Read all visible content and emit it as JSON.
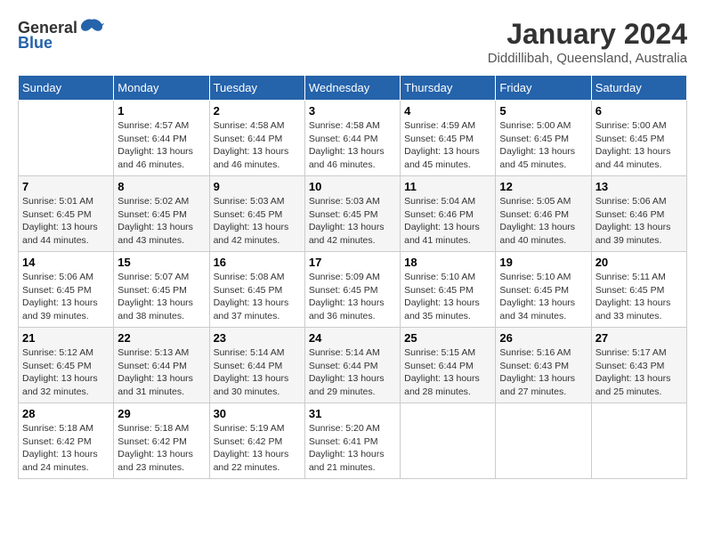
{
  "header": {
    "logo_general": "General",
    "logo_blue": "Blue",
    "month_year": "January 2024",
    "location": "Diddillibah, Queensland, Australia"
  },
  "weekdays": [
    "Sunday",
    "Monday",
    "Tuesday",
    "Wednesday",
    "Thursday",
    "Friday",
    "Saturday"
  ],
  "weeks": [
    [
      {
        "day": "",
        "sunrise": "",
        "sunset": "",
        "daylight": ""
      },
      {
        "day": "1",
        "sunrise": "Sunrise: 4:57 AM",
        "sunset": "Sunset: 6:44 PM",
        "daylight": "Daylight: 13 hours and 46 minutes."
      },
      {
        "day": "2",
        "sunrise": "Sunrise: 4:58 AM",
        "sunset": "Sunset: 6:44 PM",
        "daylight": "Daylight: 13 hours and 46 minutes."
      },
      {
        "day": "3",
        "sunrise": "Sunrise: 4:58 AM",
        "sunset": "Sunset: 6:44 PM",
        "daylight": "Daylight: 13 hours and 46 minutes."
      },
      {
        "day": "4",
        "sunrise": "Sunrise: 4:59 AM",
        "sunset": "Sunset: 6:45 PM",
        "daylight": "Daylight: 13 hours and 45 minutes."
      },
      {
        "day": "5",
        "sunrise": "Sunrise: 5:00 AM",
        "sunset": "Sunset: 6:45 PM",
        "daylight": "Daylight: 13 hours and 45 minutes."
      },
      {
        "day": "6",
        "sunrise": "Sunrise: 5:00 AM",
        "sunset": "Sunset: 6:45 PM",
        "daylight": "Daylight: 13 hours and 44 minutes."
      }
    ],
    [
      {
        "day": "7",
        "sunrise": "Sunrise: 5:01 AM",
        "sunset": "Sunset: 6:45 PM",
        "daylight": "Daylight: 13 hours and 44 minutes."
      },
      {
        "day": "8",
        "sunrise": "Sunrise: 5:02 AM",
        "sunset": "Sunset: 6:45 PM",
        "daylight": "Daylight: 13 hours and 43 minutes."
      },
      {
        "day": "9",
        "sunrise": "Sunrise: 5:03 AM",
        "sunset": "Sunset: 6:45 PM",
        "daylight": "Daylight: 13 hours and 42 minutes."
      },
      {
        "day": "10",
        "sunrise": "Sunrise: 5:03 AM",
        "sunset": "Sunset: 6:45 PM",
        "daylight": "Daylight: 13 hours and 42 minutes."
      },
      {
        "day": "11",
        "sunrise": "Sunrise: 5:04 AM",
        "sunset": "Sunset: 6:46 PM",
        "daylight": "Daylight: 13 hours and 41 minutes."
      },
      {
        "day": "12",
        "sunrise": "Sunrise: 5:05 AM",
        "sunset": "Sunset: 6:46 PM",
        "daylight": "Daylight: 13 hours and 40 minutes."
      },
      {
        "day": "13",
        "sunrise": "Sunrise: 5:06 AM",
        "sunset": "Sunset: 6:46 PM",
        "daylight": "Daylight: 13 hours and 39 minutes."
      }
    ],
    [
      {
        "day": "14",
        "sunrise": "Sunrise: 5:06 AM",
        "sunset": "Sunset: 6:45 PM",
        "daylight": "Daylight: 13 hours and 39 minutes."
      },
      {
        "day": "15",
        "sunrise": "Sunrise: 5:07 AM",
        "sunset": "Sunset: 6:45 PM",
        "daylight": "Daylight: 13 hours and 38 minutes."
      },
      {
        "day": "16",
        "sunrise": "Sunrise: 5:08 AM",
        "sunset": "Sunset: 6:45 PM",
        "daylight": "Daylight: 13 hours and 37 minutes."
      },
      {
        "day": "17",
        "sunrise": "Sunrise: 5:09 AM",
        "sunset": "Sunset: 6:45 PM",
        "daylight": "Daylight: 13 hours and 36 minutes."
      },
      {
        "day": "18",
        "sunrise": "Sunrise: 5:10 AM",
        "sunset": "Sunset: 6:45 PM",
        "daylight": "Daylight: 13 hours and 35 minutes."
      },
      {
        "day": "19",
        "sunrise": "Sunrise: 5:10 AM",
        "sunset": "Sunset: 6:45 PM",
        "daylight": "Daylight: 13 hours and 34 minutes."
      },
      {
        "day": "20",
        "sunrise": "Sunrise: 5:11 AM",
        "sunset": "Sunset: 6:45 PM",
        "daylight": "Daylight: 13 hours and 33 minutes."
      }
    ],
    [
      {
        "day": "21",
        "sunrise": "Sunrise: 5:12 AM",
        "sunset": "Sunset: 6:45 PM",
        "daylight": "Daylight: 13 hours and 32 minutes."
      },
      {
        "day": "22",
        "sunrise": "Sunrise: 5:13 AM",
        "sunset": "Sunset: 6:44 PM",
        "daylight": "Daylight: 13 hours and 31 minutes."
      },
      {
        "day": "23",
        "sunrise": "Sunrise: 5:14 AM",
        "sunset": "Sunset: 6:44 PM",
        "daylight": "Daylight: 13 hours and 30 minutes."
      },
      {
        "day": "24",
        "sunrise": "Sunrise: 5:14 AM",
        "sunset": "Sunset: 6:44 PM",
        "daylight": "Daylight: 13 hours and 29 minutes."
      },
      {
        "day": "25",
        "sunrise": "Sunrise: 5:15 AM",
        "sunset": "Sunset: 6:44 PM",
        "daylight": "Daylight: 13 hours and 28 minutes."
      },
      {
        "day": "26",
        "sunrise": "Sunrise: 5:16 AM",
        "sunset": "Sunset: 6:43 PM",
        "daylight": "Daylight: 13 hours and 27 minutes."
      },
      {
        "day": "27",
        "sunrise": "Sunrise: 5:17 AM",
        "sunset": "Sunset: 6:43 PM",
        "daylight": "Daylight: 13 hours and 25 minutes."
      }
    ],
    [
      {
        "day": "28",
        "sunrise": "Sunrise: 5:18 AM",
        "sunset": "Sunset: 6:42 PM",
        "daylight": "Daylight: 13 hours and 24 minutes."
      },
      {
        "day": "29",
        "sunrise": "Sunrise: 5:18 AM",
        "sunset": "Sunset: 6:42 PM",
        "daylight": "Daylight: 13 hours and 23 minutes."
      },
      {
        "day": "30",
        "sunrise": "Sunrise: 5:19 AM",
        "sunset": "Sunset: 6:42 PM",
        "daylight": "Daylight: 13 hours and 22 minutes."
      },
      {
        "day": "31",
        "sunrise": "Sunrise: 5:20 AM",
        "sunset": "Sunset: 6:41 PM",
        "daylight": "Daylight: 13 hours and 21 minutes."
      },
      {
        "day": "",
        "sunrise": "",
        "sunset": "",
        "daylight": ""
      },
      {
        "day": "",
        "sunrise": "",
        "sunset": "",
        "daylight": ""
      },
      {
        "day": "",
        "sunrise": "",
        "sunset": "",
        "daylight": ""
      }
    ]
  ]
}
